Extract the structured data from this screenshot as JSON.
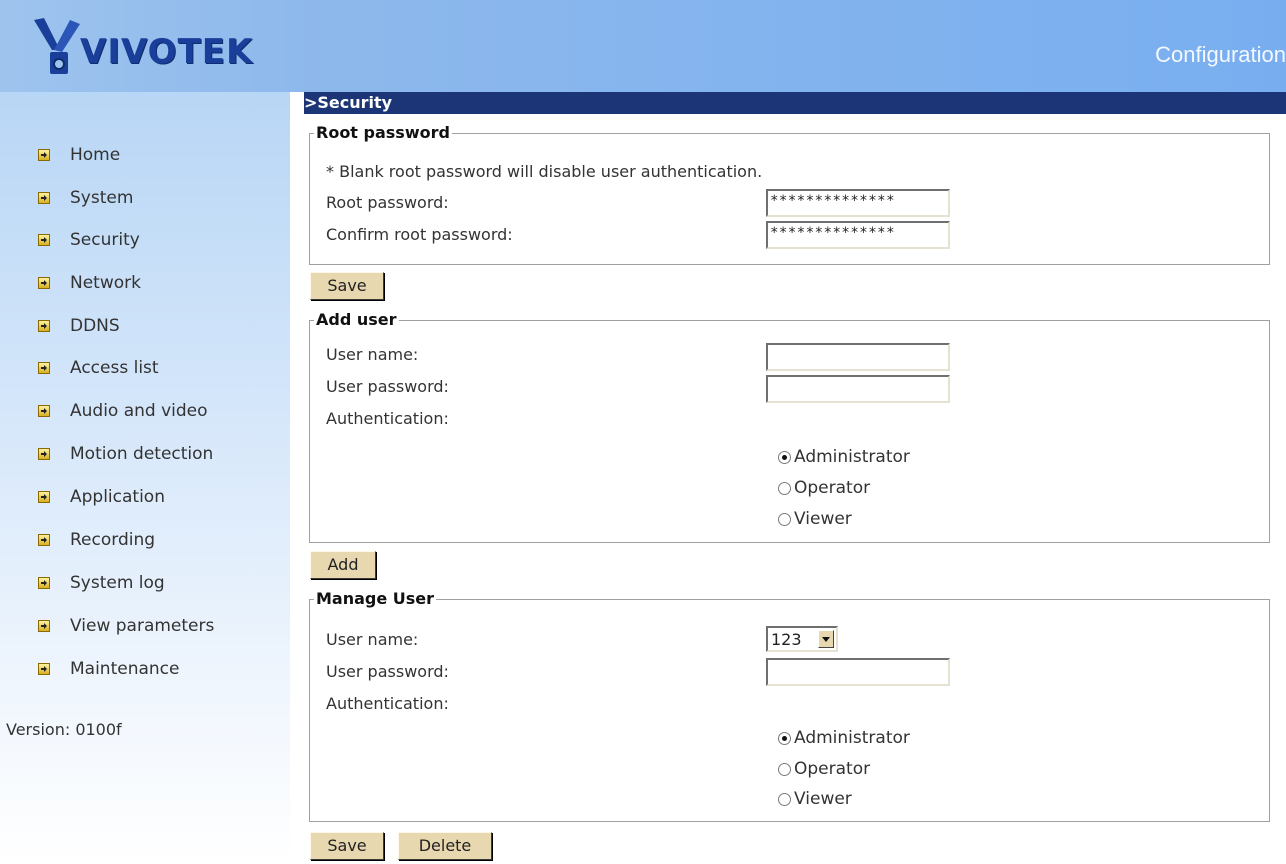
{
  "header": {
    "logo_text": "VIVOTEK",
    "title": "Configuration"
  },
  "sidebar": {
    "items": [
      {
        "label": "Home",
        "icon": "arrow-right-icon"
      },
      {
        "label": "System",
        "icon": "arrow-right-icon"
      },
      {
        "label": "Security",
        "icon": "arrow-right-icon"
      },
      {
        "label": "Network",
        "icon": "arrow-right-icon"
      },
      {
        "label": "DDNS",
        "icon": "arrow-right-icon"
      },
      {
        "label": "Access list",
        "icon": "arrow-right-icon"
      },
      {
        "label": "Audio and video",
        "icon": "arrow-right-icon"
      },
      {
        "label": "Motion detection",
        "icon": "arrow-right-icon"
      },
      {
        "label": "Application",
        "icon": "arrow-right-icon"
      },
      {
        "label": "Recording",
        "icon": "arrow-right-icon"
      },
      {
        "label": "System log",
        "icon": "arrow-right-icon"
      },
      {
        "label": "View parameters",
        "icon": "arrow-right-icon"
      },
      {
        "label": "Maintenance",
        "icon": "arrow-right-icon"
      }
    ],
    "version": "Version: 0100f"
  },
  "main": {
    "section_title": ">Security",
    "root": {
      "legend": "Root password",
      "note": "* Blank root password will disable user authentication.",
      "password_label": "Root password:",
      "password_value": "**************",
      "confirm_label": "Confirm root password:",
      "confirm_value": "**************",
      "save_label": "Save"
    },
    "add_user": {
      "legend": "Add user",
      "username_label": "User name:",
      "username_value": "",
      "password_label": "User password:",
      "password_value": "",
      "auth_label": "Authentication:",
      "options": [
        "Administrator",
        "Operator",
        "Viewer"
      ],
      "selected": "Administrator",
      "add_label": "Add"
    },
    "manage_user": {
      "legend": "Manage User",
      "username_label": "User name:",
      "username_selected": "123",
      "password_label": "User password:",
      "password_value": "",
      "auth_label": "Authentication:",
      "options": [
        "Administrator",
        "Operator",
        "Viewer"
      ],
      "selected": "Administrator",
      "save_label": "Save",
      "delete_label": "Delete"
    }
  },
  "colors": {
    "header_blue": "#78aef0",
    "section_bar": "#1c3576",
    "button_face": "#e8d8b0",
    "logo_blue": "#1a3f9a"
  }
}
